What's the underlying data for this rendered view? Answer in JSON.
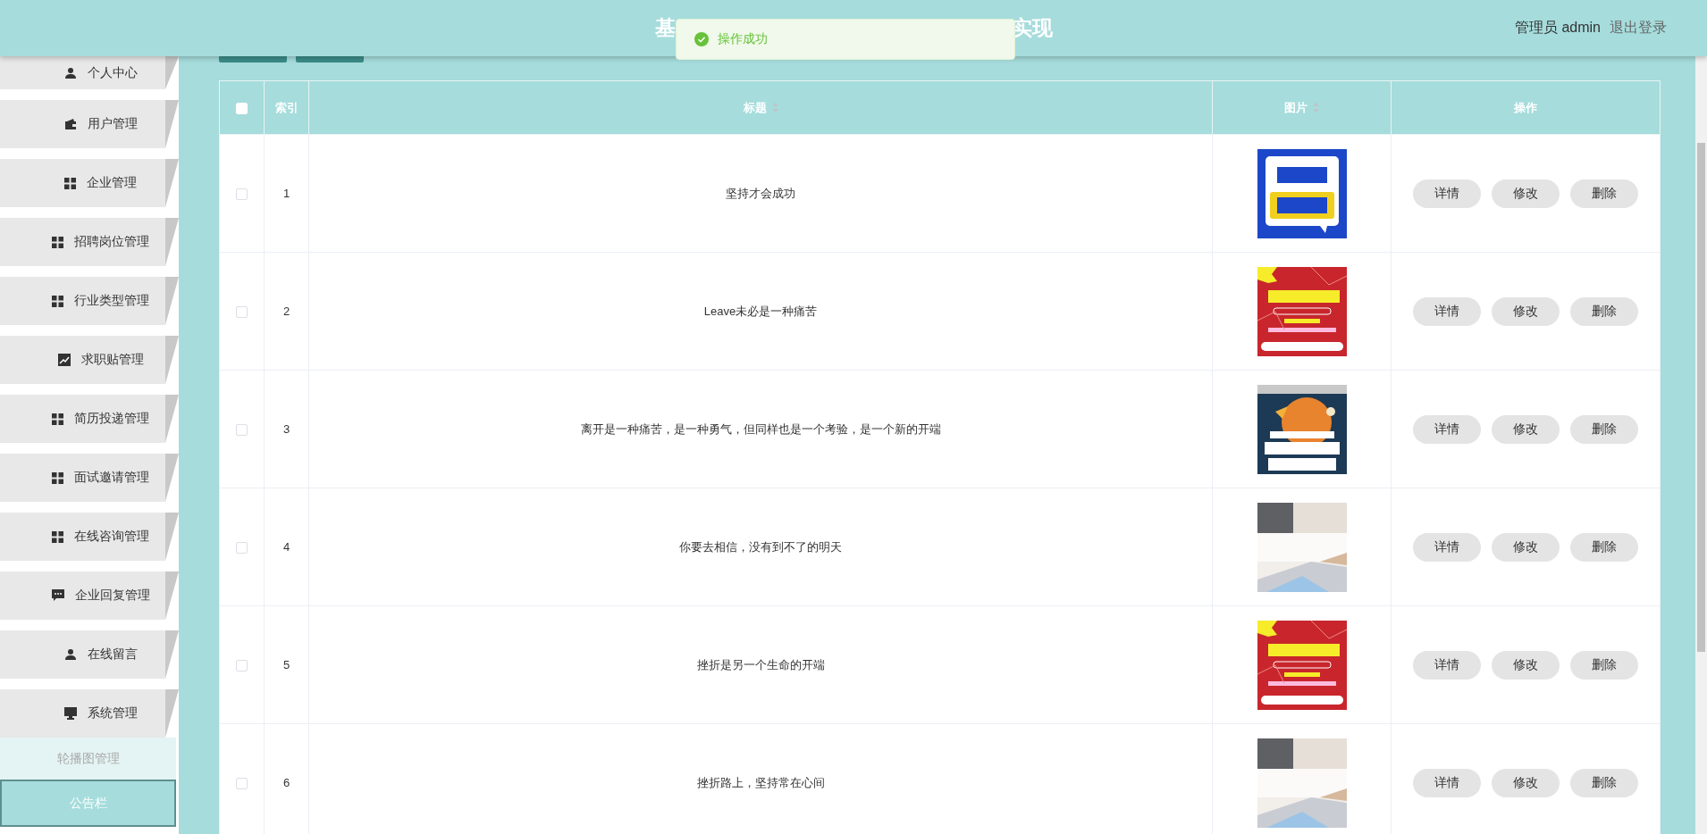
{
  "header": {
    "title_start": "基",
    "title_end": "实现",
    "user": "管理员 admin",
    "logout": "退出登录"
  },
  "toast": {
    "kind": "success",
    "message": "操作成功"
  },
  "sidebar": {
    "items": [
      {
        "label": "个人中心",
        "selected": false
      },
      {
        "label": "用户管理",
        "selected": false
      },
      {
        "label": "企业管理",
        "selected": false
      },
      {
        "label": "招聘岗位管理",
        "selected": false
      },
      {
        "label": "行业类型管理",
        "selected": false
      },
      {
        "label": "求职贴管理",
        "selected": false
      },
      {
        "label": "简历投递管理",
        "selected": false
      },
      {
        "label": "面试邀请管理",
        "selected": false
      },
      {
        "label": "在线咨询管理",
        "selected": false
      },
      {
        "label": "企业回复管理",
        "selected": false
      },
      {
        "label": "在线留言",
        "selected": false
      },
      {
        "label": "系统管理",
        "selected": false,
        "expanded": true,
        "children": [
          {
            "label": "轮播图管理",
            "selected": false
          },
          {
            "label": "公告栏",
            "selected": true
          }
        ]
      }
    ]
  },
  "table": {
    "columns": [
      {
        "kind": "checkbox",
        "checked": false
      },
      {
        "kind": "text",
        "label": "索引",
        "sortable": false
      },
      {
        "kind": "text",
        "label": "标题",
        "sortable": true
      },
      {
        "kind": "text",
        "label": "图片",
        "sortable": true
      },
      {
        "kind": "text",
        "label": "操作",
        "sortable": false
      }
    ],
    "rows": [
      {
        "checked": false,
        "index": "1",
        "title": "坚持才会成功",
        "actions": [
          "详情",
          "修改",
          "删除"
        ]
      },
      {
        "checked": false,
        "index": "2",
        "title": "Leave未必是一种痛苦",
        "actions": [
          "详情",
          "修改",
          "删除"
        ]
      },
      {
        "checked": false,
        "index": "3",
        "title": "离开是一种痛苦，是一种勇气，但同样也是一个考验，是一个新的开端",
        "actions": [
          "详情",
          "修改",
          "删除"
        ]
      },
      {
        "checked": false,
        "index": "4",
        "title": "你要去相信，没有到不了的明天",
        "actions": [
          "详情",
          "修改",
          "删除"
        ]
      },
      {
        "checked": false,
        "index": "5",
        "title": "挫折是另一个生命的开端",
        "actions": [
          "详情",
          "修改",
          "删除"
        ]
      },
      {
        "checked": false,
        "index": "6",
        "title": "挫折路上，坚持常在心间",
        "actions": [
          "详情",
          "修改",
          "删除"
        ]
      }
    ]
  }
}
